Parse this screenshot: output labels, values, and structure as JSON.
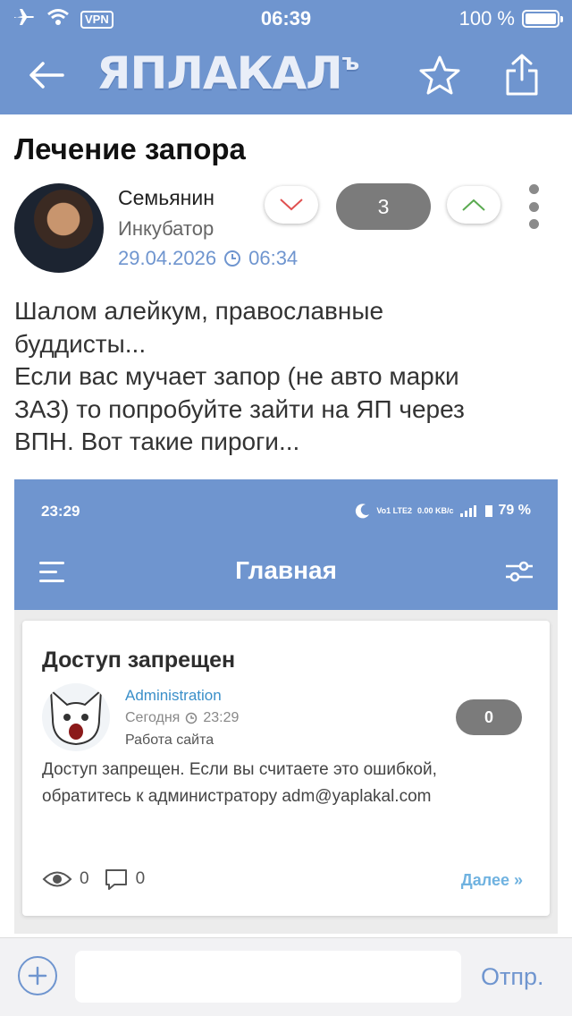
{
  "status_bar": {
    "vpn_label": "VPN",
    "time": "06:39",
    "battery_percent": "100 %",
    "battery_level": 1.0
  },
  "navbar": {
    "logo_text": "ЯПЛАКАЛ",
    "logo_suffix": "ъ",
    "accent_color": "#6f95cf"
  },
  "post": {
    "title": "Лечение запора",
    "author": "Семьянин",
    "rank": "Инкубатор",
    "date": "29.04.2026",
    "time": "06:34",
    "score": "3",
    "body": [
      "Шалом алейкум, православные",
      "буддисты...",
      "Если вас мучает запор (не авто марки",
      "ЗАЗ) то попробуйте зайти на ЯП через",
      "ВПН.  Вот такие пироги..."
    ]
  },
  "embedded_screenshot": {
    "time": "23:29",
    "network_1": "Vo1 LTE2",
    "speed": "0.00 KB/c",
    "battery_percent": "79 %",
    "heading": "Главная",
    "card": {
      "title": "Доступ запрещен",
      "author": "Administration",
      "date": "Сегодня",
      "time": "23:29",
      "forum": "Работа сайта",
      "score": "0",
      "text": "Доступ запрещен. Если вы считаете это ошибкой, обратитесь к администратору adm@yaplakal.com",
      "views": "0",
      "comments": "0",
      "more_label": "Далее »"
    }
  },
  "composer": {
    "placeholder": "",
    "send_label": "Отпр."
  }
}
